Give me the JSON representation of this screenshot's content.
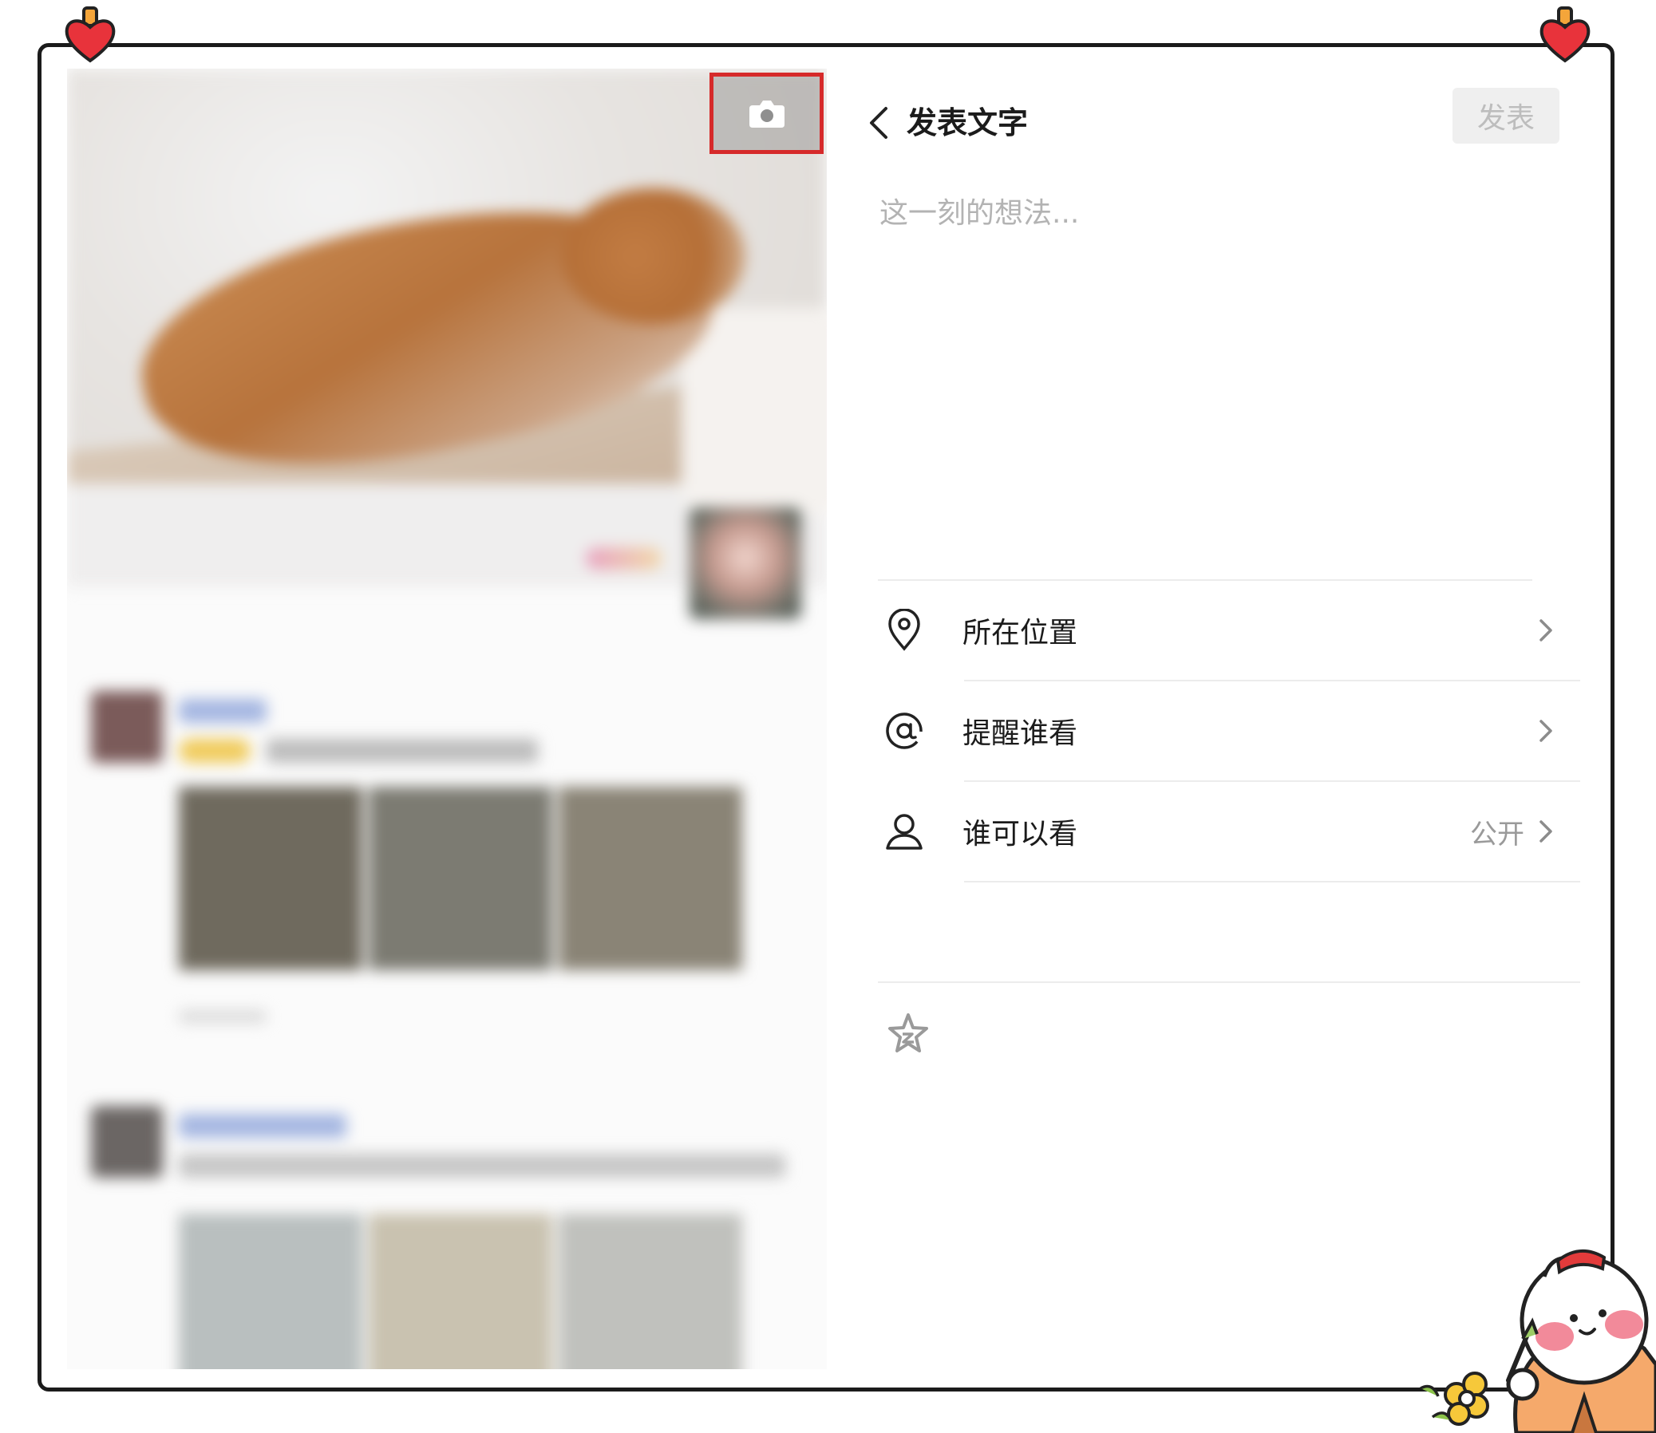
{
  "compose": {
    "title": "发表文字",
    "publish_label": "发表",
    "placeholder": "这一刻的想法...",
    "rows": [
      {
        "icon": "location-pin-icon",
        "label": "所在位置",
        "value": ""
      },
      {
        "icon": "at-icon",
        "label": "提醒谁看",
        "value": ""
      },
      {
        "icon": "person-icon",
        "label": "谁可以看",
        "value": "公开"
      }
    ]
  },
  "colors": {
    "highlight_box": "#d62a2a",
    "frame": "#1b1b1b",
    "heart": "#e8333b"
  },
  "icons": [
    "back-chevron-icon",
    "camera-icon",
    "chevron-right-icon",
    "star-icon",
    "heart-pin-icon",
    "cat-sticker-icon",
    "flower-icon"
  ]
}
